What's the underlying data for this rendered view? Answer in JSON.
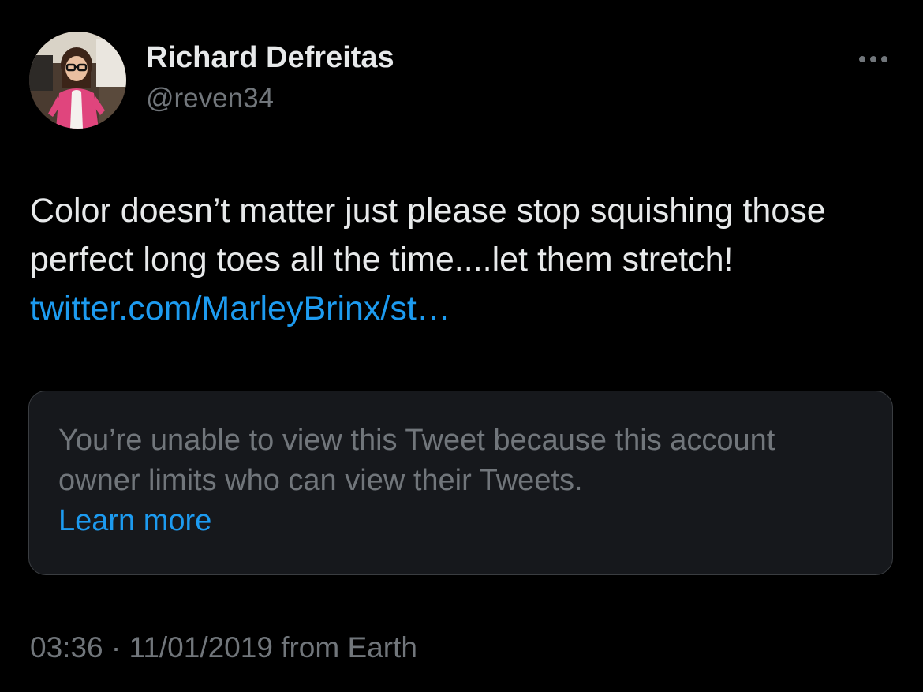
{
  "author": {
    "display_name": "Richard Defreitas",
    "handle": "@reven34",
    "avatar_icon": "user-avatar-photo"
  },
  "more_icon": "more-horizontal-icon",
  "tweet": {
    "text": "Color doesn’t matter just please stop squishing those perfect long toes all the time....let them stretch! ",
    "link_text": "twitter.com/MarleyBrinx/st…"
  },
  "quote_card": {
    "message": "You’re unable to view this Tweet because this account owner limits who can view their Tweets.",
    "learn_more": "Learn more"
  },
  "meta": {
    "time": "03:36",
    "separator": " · ",
    "date": "11/01/2019",
    "source": " from Earth"
  },
  "colors": {
    "background": "#000000",
    "primary_text": "#e7e9ea",
    "secondary_text": "#71767b",
    "link": "#1d9bf0",
    "card_border": "#3a3d41",
    "card_background": "#16181c"
  }
}
